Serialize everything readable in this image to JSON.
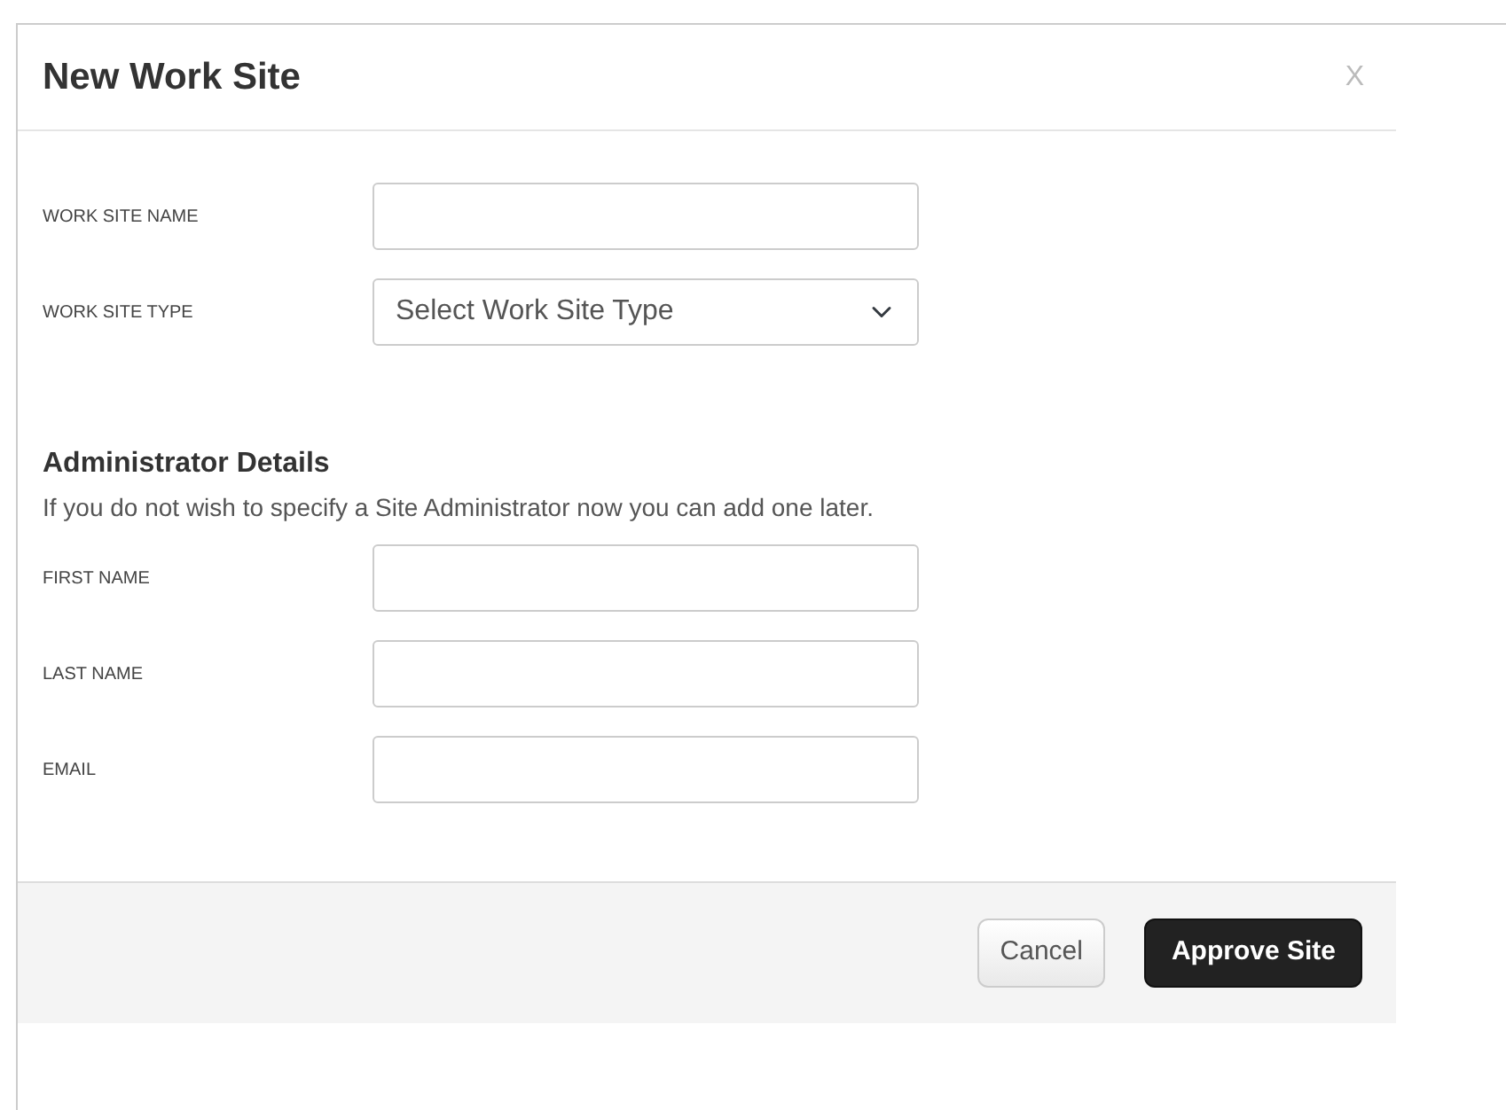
{
  "dialog": {
    "title": "New Work Site",
    "close": "X"
  },
  "site_fields": [
    {
      "label": "WORK SITE NAME",
      "kind": "text"
    },
    {
      "label": "WORK SITE TYPE",
      "kind": "select",
      "value": "Select Work Site Type"
    }
  ],
  "admin": {
    "heading": "Administrator Details",
    "note": "If you do not wish to specify a Site Administrator now you can add one later."
  },
  "admin_fields": [
    {
      "label": "FIRST NAME",
      "kind": "text"
    },
    {
      "label": "LAST NAME",
      "kind": "text"
    },
    {
      "label": "EMAIL",
      "kind": "text"
    }
  ],
  "buttons": [
    {
      "label": "Cancel",
      "kind": "secondary"
    },
    {
      "label": "Approve Site",
      "kind": "primary"
    }
  ]
}
